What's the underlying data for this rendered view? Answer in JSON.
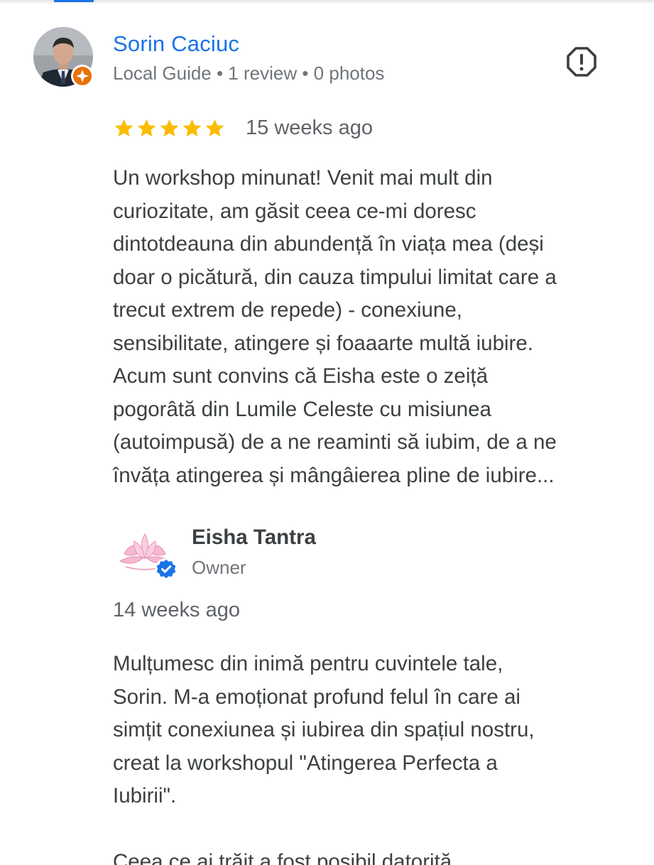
{
  "review": {
    "author": "Sorin Caciuc",
    "meta": "Local Guide • 1 review • 0 photos",
    "rating": 5,
    "date": "15 weeks ago",
    "text": "Un workshop minunat! Venit mai mult din\ncuriozitate, am găsit ceea ce-mi doresc\ndintotdeauna din abundență în viața mea (deși\ndoar o picătură, din cauza timpului limitat care a\ntrecut extrem de repede) - conexiune,\nsensibilitate, atingere și foaaarte multă iubire.\nAcum sunt convins că Eisha este o zeiță\npogorâtă din Lumile Celeste cu misiunea\n(autoimpusă) de a ne reaminti să iubim, de a ne\nînvăța atingerea și mângâierea pline de iubire..."
  },
  "owner_reply": {
    "name": "Eisha Tantra",
    "role": "Owner",
    "date": "14 weeks ago",
    "text": "Mulțumesc din inimă pentru cuvintele tale,\nSorin. M-a emoționat profund felul în care ai\nsimțit conexiunea și iubirea din spațiul nostru,\ncreat la workshopul \"Atingerea Perfecta a\nIubirii\".\n\nCeea ce ai trăit a fost posibil datorită"
  },
  "icons": {
    "report": "report-flag-icon",
    "star": "star-icon",
    "local_guide_badge": "local-guide-badge-icon",
    "verified": "verified-check-icon"
  },
  "colors": {
    "link_blue": "#1a73e8",
    "star_gold": "#fbbc04",
    "badge_orange": "#e8710a",
    "text": "#3c4043",
    "secondary_text": "#70757a"
  }
}
